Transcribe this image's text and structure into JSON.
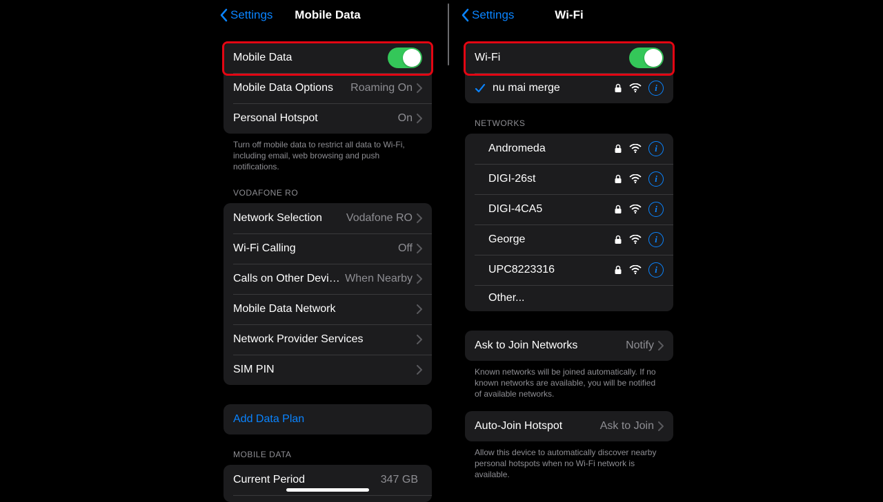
{
  "left": {
    "back_label": "Settings",
    "title": "Mobile Data",
    "toggle_row_label": "Mobile Data",
    "options_label": "Mobile Data Options",
    "options_value": "Roaming On",
    "hotspot_label": "Personal Hotspot",
    "hotspot_value": "On",
    "footer1": "Turn off mobile data to restrict all data to Wi-Fi, including email, web browsing and push notifications.",
    "section_carrier": "VODAFONE RO",
    "network_selection_label": "Network Selection",
    "network_selection_value": "Vodafone RO",
    "wifi_calling_label": "Wi-Fi Calling",
    "wifi_calling_value": "Off",
    "calls_other_label": "Calls on Other Devices",
    "calls_other_value": "When Nearby",
    "mdn_label": "Mobile Data Network",
    "nps_label": "Network Provider Services",
    "sim_pin_label": "SIM PIN",
    "add_data_plan_label": "Add Data Plan",
    "section_usage": "MOBILE DATA",
    "current_period_label": "Current Period",
    "current_period_value": "347 GB"
  },
  "right": {
    "back_label": "Settings",
    "title": "Wi-Fi",
    "toggle_row_label": "Wi-Fi",
    "connected_network": "nu mai merge",
    "section_networks": "NETWORKS",
    "networks": [
      {
        "name": "Andromeda"
      },
      {
        "name": "DIGI-26st"
      },
      {
        "name": "DIGI-4CA5"
      },
      {
        "name": "George"
      },
      {
        "name": "UPC8223316"
      }
    ],
    "other_label": "Other...",
    "ask_join_label": "Ask to Join Networks",
    "ask_join_value": "Notify",
    "ask_join_footer": "Known networks will be joined automatically. If no known networks are available, you will be notified of available networks.",
    "auto_hotspot_label": "Auto-Join Hotspot",
    "auto_hotspot_value": "Ask to Join",
    "auto_hotspot_footer": "Allow this device to automatically discover nearby personal hotspots when no Wi-Fi network is available."
  }
}
